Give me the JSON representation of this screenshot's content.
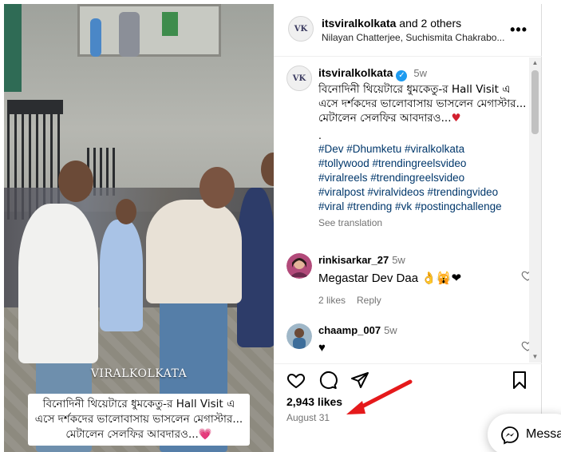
{
  "media": {
    "watermark": "VIRALKOLKATA",
    "caption_line": "বিনোদিনী থিয়েটারে ধুমকেতু-র Hall Visit এ এসে দর্শকদের ভালোবাসায় ভাসলেন মেগাস্টার... মেটালেন সেলফির আবদারও...",
    "caption_emoji": "💗"
  },
  "header": {
    "avatar_text": "VK",
    "user": "itsviralkolkata",
    "and_others": " and 2 others",
    "collaborators": "Nilayan Chatterjee, Suchismita Chakrabo..."
  },
  "caption": {
    "avatar_text": "VK",
    "user": "itsviralkolkata",
    "verified_mark": "✓",
    "age": "5w",
    "text": "বিনোদিনী থিয়েটারে ধুমকেতু-র Hall Visit এ এসে দর্শকদের ভালোবাসায় ভাসলেন মেগাস্টার... মেটালেন সেলফির আবদারও...",
    "heart": "♥",
    "dot": ".",
    "hashtags": [
      "#Dev #Dhumketu #viralkolkata",
      "#tollywood #trendingreelsvideo",
      "#viralreels #trendingreelsvideo",
      "#viralpost #viralvideos #trendingvideo",
      "#viral #trending #vk #postingchallenge"
    ],
    "see_translation": "See translation"
  },
  "comments": [
    {
      "user": "rinkisarkar_27",
      "age": "5w",
      "text": "Megastar Dev Daa 👌🙀❤",
      "likes": "2 likes",
      "reply": "Reply"
    },
    {
      "user": "chaamp_007",
      "age": "5w",
      "text": "♥"
    }
  ],
  "post": {
    "likes": "2,943 likes",
    "date": "August 31"
  },
  "messages": {
    "label": "Messages"
  },
  "colors": {
    "link": "#00376b",
    "muted": "#737373",
    "verified": "#1d9bf0",
    "annotation_arrow": "#e5191b"
  }
}
